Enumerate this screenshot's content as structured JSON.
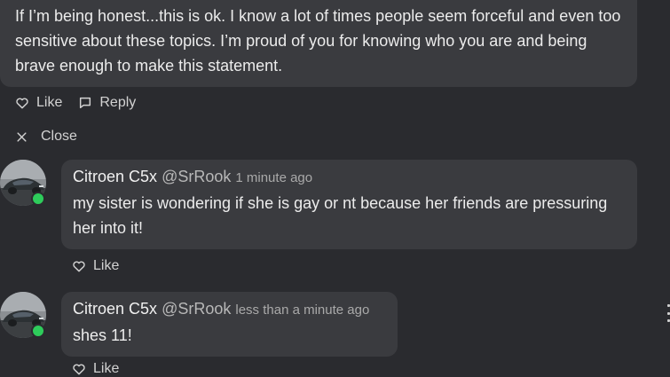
{
  "thread": {
    "parent": {
      "text": "If I’m being honest...this is ok. I know a lot of times people seem forceful and even too sensitive about these topics. I’m proud of you for knowing who you are and being brave enough to make this statement.",
      "like_label": "Like",
      "reply_label": "Reply"
    },
    "close_label": "Close",
    "replies": [
      {
        "author": "Citroen C5x",
        "handle": "@SrRook",
        "time": "1 minute ago",
        "text": "my sister is wondering if she is gay or nt because her friends are pressuring her into it!",
        "like_label": "Like",
        "avatar_icon": "car-avatar",
        "online": true
      },
      {
        "author": "Citroen C5x",
        "handle": "@SrRook",
        "time": "less than a minute ago",
        "text": "shes 11!",
        "like_label": "Like",
        "avatar_icon": "car-avatar",
        "online": true
      }
    ]
  },
  "colors": {
    "background": "#2a2b2f",
    "bubble": "#3a3b3f",
    "online": "#2ecc5b"
  }
}
